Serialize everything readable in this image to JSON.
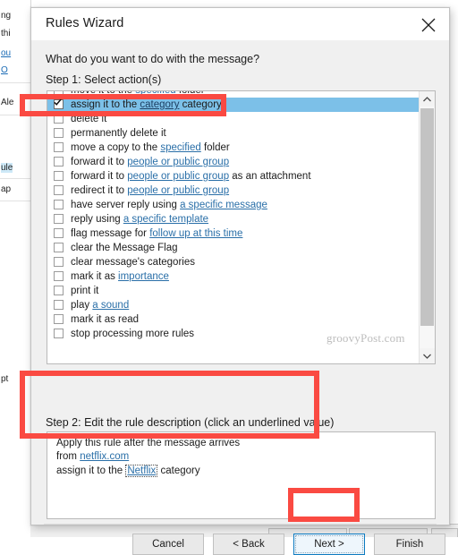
{
  "window": {
    "title": "Rules Wizard",
    "close_label": "Close",
    "close_icon": "close-icon"
  },
  "main": {
    "question": "What do you want to do with the message?",
    "step1_label": "Step 1: Select action(s)",
    "step2_label": "Step 2: Edit the rule description (click an underlined value)"
  },
  "actions": [
    {
      "text_before": "move it to the ",
      "link": "specified",
      "text_after": " folder",
      "checked": false,
      "selected": false
    },
    {
      "text_before": "assign it to the ",
      "link": "category",
      "text_after": " category",
      "checked": true,
      "selected": true
    },
    {
      "text_before": "delete it",
      "link": "",
      "text_after": "",
      "checked": false,
      "selected": false
    },
    {
      "text_before": "permanently delete it",
      "link": "",
      "text_after": "",
      "checked": false,
      "selected": false
    },
    {
      "text_before": "move a copy to the ",
      "link": "specified",
      "text_after": " folder",
      "checked": false,
      "selected": false
    },
    {
      "text_before": "forward it to ",
      "link": "people or public group",
      "text_after": "",
      "checked": false,
      "selected": false
    },
    {
      "text_before": "forward it to ",
      "link": "people or public group",
      "text_after": " as an attachment",
      "checked": false,
      "selected": false
    },
    {
      "text_before": "redirect it to ",
      "link": "people or public group",
      "text_after": "",
      "checked": false,
      "selected": false
    },
    {
      "text_before": "have server reply using ",
      "link": "a specific message",
      "text_after": "",
      "checked": false,
      "selected": false
    },
    {
      "text_before": "reply using ",
      "link": "a specific template",
      "text_after": "",
      "checked": false,
      "selected": false
    },
    {
      "text_before": "flag message for ",
      "link": "follow up at this time",
      "text_after": "",
      "checked": false,
      "selected": false
    },
    {
      "text_before": "clear the Message Flag",
      "link": "",
      "text_after": "",
      "checked": false,
      "selected": false
    },
    {
      "text_before": "clear message's categories",
      "link": "",
      "text_after": "",
      "checked": false,
      "selected": false
    },
    {
      "text_before": "mark it as ",
      "link": "importance",
      "text_after": "",
      "checked": false,
      "selected": false
    },
    {
      "text_before": "print it",
      "link": "",
      "text_after": "",
      "checked": false,
      "selected": false
    },
    {
      "text_before": "play ",
      "link": "a sound",
      "text_after": "",
      "checked": false,
      "selected": false
    },
    {
      "text_before": "mark it as read",
      "link": "",
      "text_after": "",
      "checked": false,
      "selected": false
    },
    {
      "text_before": "stop processing more rules",
      "link": "",
      "text_after": "",
      "checked": false,
      "selected": false
    }
  ],
  "description": {
    "line1": "Apply this rule after the message arrives",
    "line2_prefix": "from ",
    "line2_link": "netflix.com",
    "line3_prefix": "assign it to the ",
    "line3_value": "Netflix",
    "line3_suffix": " category"
  },
  "footer": {
    "cancel": "Cancel",
    "back": "< Back",
    "next": "Next >",
    "finish": "Finish"
  },
  "watermark": "groovyPost.com",
  "background": {
    "fragments": [
      "ng",
      "thi",
      "ou",
      "O",
      "Ale",
      "ule",
      "ap",
      "pt"
    ]
  },
  "colors": {
    "selection": "#7cc0e8",
    "link": "#2a6fa8",
    "annotation": "#fa4a42",
    "next_focus_border": "#0c7ac0",
    "dialog_bg": "#f0f0f0"
  },
  "annotations": [
    {
      "name": "assign-category-row",
      "shape": "rectangle"
    },
    {
      "name": "step2-description",
      "shape": "rectangle"
    },
    {
      "name": "next-button",
      "shape": "rectangle"
    }
  ]
}
